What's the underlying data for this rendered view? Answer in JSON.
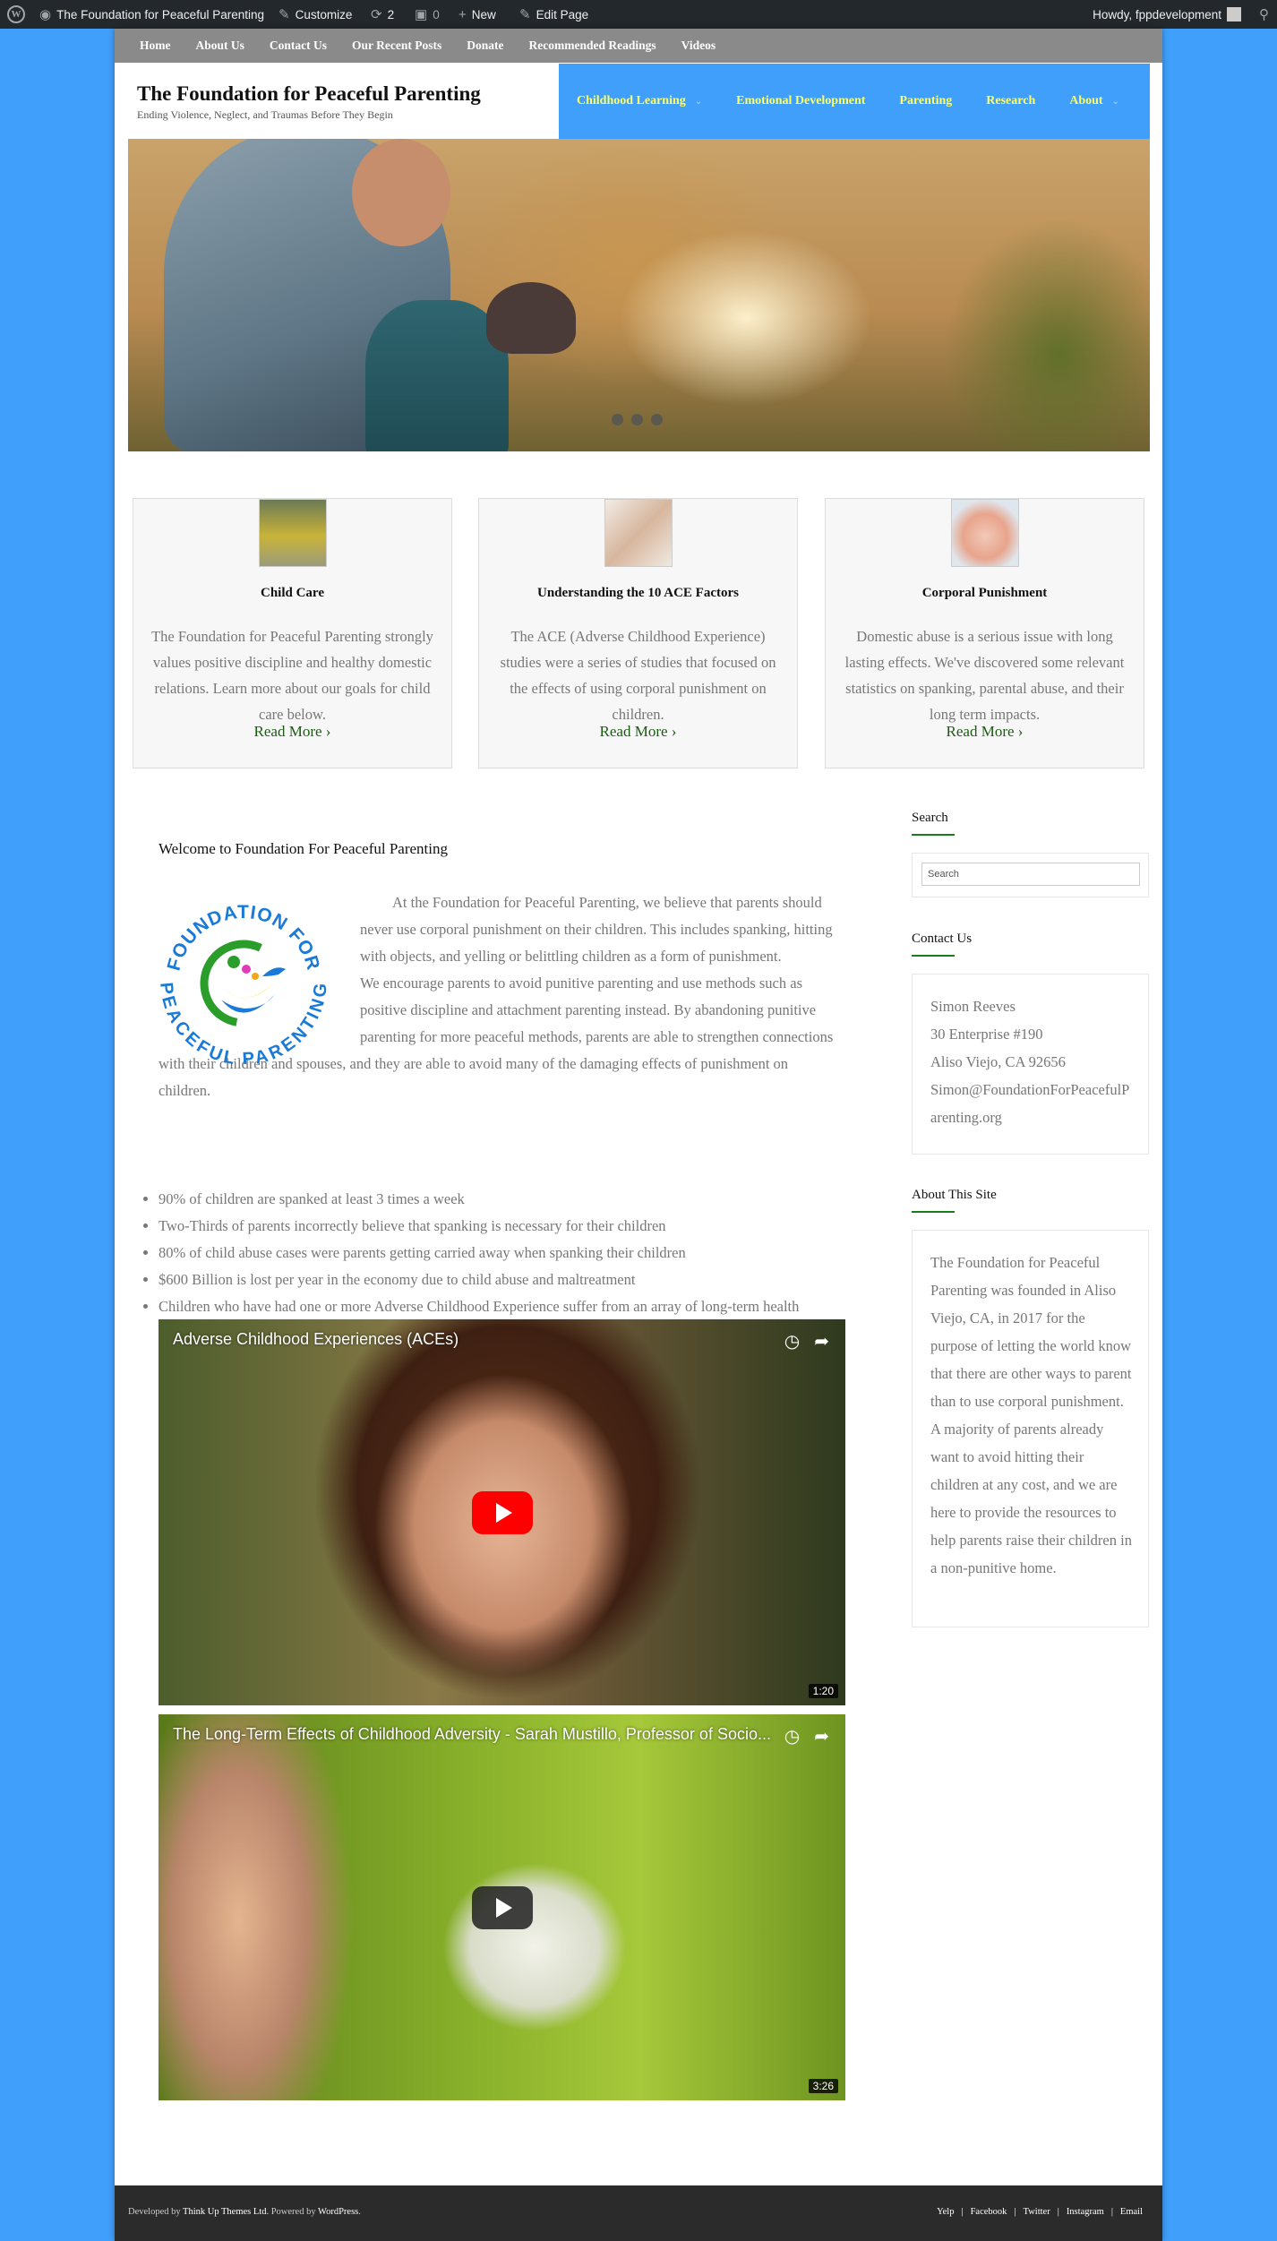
{
  "admin_bar": {
    "site_name": "The Foundation for Peaceful Parenting",
    "customize": "Customize",
    "updates_count": "2",
    "comments_count": "0",
    "new_label": "New",
    "edit_page": "Edit Page",
    "howdy": "Howdy, fppdevelopment"
  },
  "top_nav": [
    "Home",
    "About Us",
    "Contact Us",
    "Our Recent Posts",
    "Donate",
    "Recommended Readings",
    "Videos"
  ],
  "site": {
    "title": "The Foundation for Peaceful Parenting",
    "tagline": "Ending Violence, Neglect, and Traumas Before They Begin"
  },
  "main_nav": [
    "Childhood Learning",
    "Emotional Development",
    "Parenting",
    "Research",
    "About"
  ],
  "features": [
    {
      "title": "Child Care",
      "text": "The Foundation for Peaceful Parenting strongly values positive discipline and healthy domestic relations. Learn more about our goals for child care below.",
      "link": "Read More"
    },
    {
      "title": "Understanding the 10 ACE Factors",
      "text": "The ACE (Adverse Childhood Experience) studies were a series of studies that focused on the effects of using corporal punishment on children.",
      "link": "Read More"
    },
    {
      "title": "Corporal Punishment",
      "text": "Domestic abuse is a serious issue with long lasting effects. We've discovered some relevant statistics on spanking, parental abuse, and their long term impacts.",
      "link": "Read More"
    }
  ],
  "content": {
    "welcome": "Welcome to Foundation For Peaceful Parenting",
    "logo_text_top": "FOUNDATION FOR",
    "logo_text_bottom": "PEACEFUL PARENTING",
    "paragraph1": "At the Foundation for Peaceful Parenting, we believe that parents should never use corporal punishment on their children. This includes spanking, hitting with objects, and yelling or belittling children as a form of punishment.",
    "paragraph2": "We encourage parents to avoid punitive parenting and use methods such as positive discipline and attachment parenting instead. By abandoning punitive parenting for more peaceful methods, parents are able to strengthen connections with their children and spouses, and they are able to avoid many of the damaging effects of punishment on children.",
    "stats": [
      "90% of children are spanked at least 3 times a week",
      "Two-Thirds of parents incorrectly believe that spanking is necessary for their children",
      "80% of child abuse cases were parents getting carried away when spanking their children",
      "$600 Billion is lost per year in the economy due to child abuse and maltreatment",
      "Children who have had one or more Adverse Childhood Experience suffer from an array of long-term health problems later in life"
    ],
    "videos": [
      {
        "title": "Adverse Childhood Experiences (ACEs)",
        "duration": "1:20"
      },
      {
        "title": "The Long-Term Effects of Childhood Adversity - Sarah Mustillo, Professor of Socio...",
        "duration": "3:26"
      }
    ]
  },
  "sidebar": {
    "search_title": "Search",
    "search_placeholder": "Search",
    "contact_title": "Contact Us",
    "contact_lines": [
      "Simon Reeves",
      "30 Enterprise #190",
      "Aliso Viejo, CA 92656",
      "Simon@FoundationForPeacefulParenting.org"
    ],
    "about_title": "About This Site",
    "about_text": "The Foundation for Peaceful Parenting was founded in Aliso Viejo, CA, in 2017 for the purpose of letting the world know that there are other ways to parent than to use corporal punishment. A majority of parents already want to avoid hitting their children at any cost, and we are here to provide the resources to help parents raise their children in a non-punitive home."
  },
  "footer": {
    "developed_by": "Developed by",
    "developer": "Think Up Themes Ltd",
    "powered_by": ". Powered by",
    "platform": "WordPress",
    "period": ".",
    "links": [
      "Yelp",
      "Facebook",
      "Twitter",
      "Instagram",
      "Email"
    ]
  },
  "colors": {
    "background": "#3f9ffa",
    "main_nav_text": "#ffff66",
    "link_green": "#1b5a12",
    "youtube_red": "#ff0000"
  }
}
